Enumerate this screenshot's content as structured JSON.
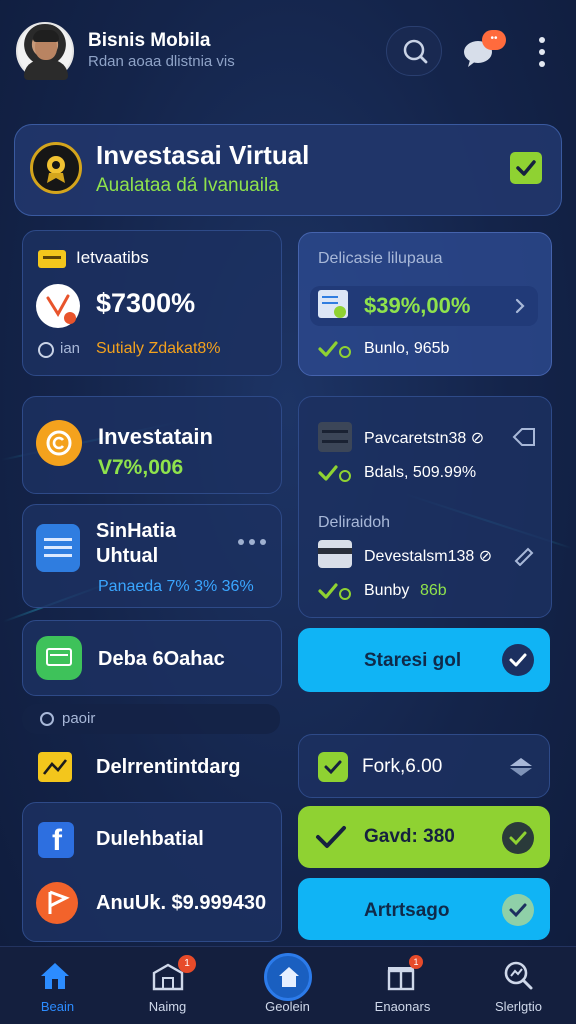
{
  "header": {
    "title": "Bisnis Mobila",
    "subtitle": "Rdan aoaa dlistnia vis",
    "chat_badge": "••",
    "icons": [
      "search-icon",
      "chat-icon",
      "more-vertical-icon"
    ]
  },
  "hero": {
    "title": "Investasai Virtual",
    "subtitle": "Aualataa dá Ivanuaila",
    "icon": "award-icon",
    "accent": "#8fd232"
  },
  "stats_card": {
    "label": "Ietvaatibs",
    "value": "$7300%",
    "status_prefix": "ian",
    "status_text": "Sutialy Zdakat8%"
  },
  "delicasie_card": {
    "title": "Delicasie lilupaua",
    "value": "$39%,00%",
    "footer": "Bunlo, 965b"
  },
  "invest_card": {
    "title": "Investatain",
    "value": "V7%,006"
  },
  "simulasi_card": {
    "title_line1": "SinHatia",
    "title_line2": "Uhtual",
    "footer": "Panaeda 7% 3% 36%"
  },
  "right_list": {
    "item1_title": "Pavcaretstn38 ⊘",
    "item1_sub": "Bdals, 509.99%",
    "section": "Deliraidoh",
    "item2_title": "Devestalsm138 ⊘",
    "item2_sub": "Bunby",
    "item2_value": "86b"
  },
  "deba_card": {
    "label": "Deba 6Oahac"
  },
  "start_button": {
    "label": "Staresi gol"
  },
  "section_chip": {
    "label": "paoir"
  },
  "row_delren": {
    "label": "Delrrentintdarg"
  },
  "row_fork": {
    "label": "Fork,6.00"
  },
  "row_duleh": {
    "label": "Dulehbatial"
  },
  "row_save": {
    "label": "Gavd: 380"
  },
  "row_anduk": {
    "label": "AnuUk. $9.999430"
  },
  "row_artrt": {
    "label": "Artrtsago"
  },
  "bottom_nav": [
    {
      "label": "Beain",
      "icon": "home-icon",
      "active": false
    },
    {
      "label": "Naimg",
      "icon": "store-icon",
      "badge": "1"
    },
    {
      "label": "Geolein",
      "icon": "house-icon",
      "active": true
    },
    {
      "label": "Enaonars",
      "icon": "gift-icon",
      "badge": "1"
    },
    {
      "label": "Slerlgtio",
      "icon": "search-chart-icon"
    }
  ],
  "colors": {
    "background": "#14244a",
    "card": "#1c3060",
    "lime": "#8fd232",
    "cyan": "#10b4f5",
    "orange": "#f4a21d"
  }
}
